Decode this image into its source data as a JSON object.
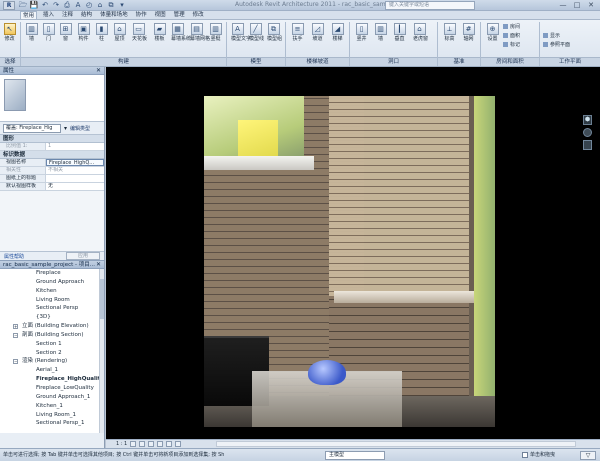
{
  "window": {
    "title": "Autodesk Revit Architecture 2011 - rac_basic_sample_project.rvt - ...",
    "search_placeholder": "键入关键字或短语",
    "app_logo": "R",
    "min": "—",
    "max": "□",
    "close": "✕"
  },
  "qat": [
    "🗁",
    "💾",
    "↶",
    "↷",
    "⎙",
    "A",
    "◴",
    "⌂",
    "⧉",
    "▾"
  ],
  "menu": [
    "常用",
    "插入",
    "注释",
    "结构",
    "体量和场地",
    "协作",
    "视图",
    "管理",
    "修改"
  ],
  "ribbon": {
    "buttons": [
      {
        "label": "修改",
        "icon": "↖"
      },
      {
        "label": "墙",
        "icon": "▥"
      },
      {
        "label": "门",
        "icon": "▯"
      },
      {
        "label": "窗",
        "icon": "⊞"
      },
      {
        "label": "构件",
        "icon": "▣"
      },
      {
        "label": "柱",
        "icon": "▮"
      },
      {
        "label": "屋顶",
        "icon": "⌂"
      },
      {
        "label": "天花板",
        "icon": "▭"
      },
      {
        "label": "楼板",
        "icon": "▰"
      },
      {
        "label": "幕墙系统",
        "icon": "▦"
      },
      {
        "label": "幕墙网格",
        "icon": "▤"
      },
      {
        "label": "竖梃",
        "icon": "▥"
      },
      {
        "label": "模型文字",
        "icon": "A"
      },
      {
        "label": "模型线",
        "icon": "╱"
      },
      {
        "label": "模型组",
        "icon": "⧉"
      },
      {
        "label": "扶手",
        "icon": "≡"
      },
      {
        "label": "坡道",
        "icon": "◿"
      },
      {
        "label": "楼梯",
        "icon": "◢"
      },
      {
        "label": "竖井",
        "icon": "▯"
      },
      {
        "label": "墙",
        "icon": "▥"
      },
      {
        "label": "垂直",
        "icon": "┃"
      },
      {
        "label": "老虎窗",
        "icon": "⌂"
      },
      {
        "label": "标高",
        "icon": "⟂"
      },
      {
        "label": "轴网",
        "icon": "#"
      },
      {
        "label": "设置",
        "icon": "⊕"
      }
    ],
    "small_buttons": [
      "房间",
      "面积",
      "标记",
      "显示",
      "参照平面"
    ],
    "panels": [
      "选择",
      "构建",
      "模型",
      "楼梯坡道",
      "洞口",
      "基准",
      "房间和面积",
      "工作平面"
    ]
  },
  "properties": {
    "title": "属性",
    "type_selector": "覆盖: Fireplace_Hig",
    "edit_type": "编辑类型",
    "rows_graphics": [
      {
        "k": "图形",
        "v": "",
        "section": true
      },
      {
        "k": "比例值 1:",
        "v": "1",
        "gray": true
      }
    ],
    "section_id": "标识数据",
    "rows_id": [
      {
        "k": "视图名称",
        "v": "Fireplace_HighQ...",
        "hl": true
      },
      {
        "k": "相关性",
        "v": "不相关",
        "gray": true
      },
      {
        "k": "图纸上的标题",
        "v": ""
      },
      {
        "k": "默认视图样板",
        "v": "无"
      }
    ],
    "help": "属性帮助",
    "apply": "应用"
  },
  "browser": {
    "title": "rac_basic_sample_project - 项目...",
    "items": [
      {
        "label": "Fireplace",
        "indent": 36
      },
      {
        "label": "Ground Approach",
        "indent": 36
      },
      {
        "label": "Kitchen",
        "indent": 36
      },
      {
        "label": "Living Room",
        "indent": 36
      },
      {
        "label": "Sectional Persp",
        "indent": 36
      },
      {
        "label": "{3D}",
        "indent": 36
      },
      {
        "label": "立面 (Building Elevation)",
        "indent": 22,
        "tw": "+"
      },
      {
        "label": "剖面 (Building Section)",
        "indent": 22,
        "tw": "−"
      },
      {
        "label": "Section 1",
        "indent": 36
      },
      {
        "label": "Section 2",
        "indent": 36
      },
      {
        "label": "渲染 (Rendering)",
        "indent": 22,
        "tw": "−"
      },
      {
        "label": "Aerial_1",
        "indent": 36
      },
      {
        "label": "Fireplace_HighQualit",
        "indent": 36,
        "bold": true
      },
      {
        "label": "Fireplace_LowQuality",
        "indent": 36
      },
      {
        "label": "Ground Approach_1",
        "indent": 36
      },
      {
        "label": "Kitchen_1",
        "indent": 36
      },
      {
        "label": "Living Room_1",
        "indent": 36
      },
      {
        "label": "Sectional Persp_1",
        "indent": 36
      }
    ]
  },
  "view": {
    "scale": "1 : 1",
    "nav_cube": "⬢"
  },
  "status": {
    "message": "单击可进行选择; 按 Tab 键并单击可选择其他项目; 按 Ctrl 键并单击可将新项目添加到选择集; 按 Sh",
    "workset": "主模型",
    "press_drag": "单击和拖曳",
    "filter": "▽"
  }
}
